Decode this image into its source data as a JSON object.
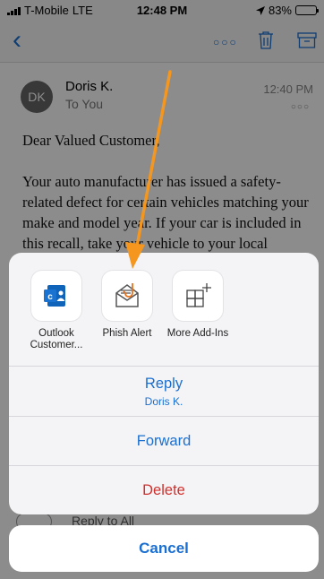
{
  "status_bar": {
    "carrier": "T-Mobile",
    "network": "LTE",
    "time": "12:48 PM",
    "battery": "83%",
    "battery_color": "#f4c20d"
  },
  "nav": {
    "back_icon": "chevron-left-icon",
    "more_icon": "ellipsis-icon",
    "more_glyph": "○○○",
    "trash_icon": "trash-icon",
    "archive_icon": "archive-icon"
  },
  "message": {
    "avatar_initials": "DK",
    "sender": "Doris K.",
    "recipient": "To You",
    "time": "12:40 PM",
    "dots": "○○○",
    "greeting": "Dear Valued Customer,",
    "body": "Your auto manufacturer has issued a safety-related defect for certain vehicles matching your make and model year. If your car is included in this recall, take your vehicle to your local"
  },
  "reply_bar": {
    "label": "Reply to All"
  },
  "action_sheet": {
    "addins": [
      {
        "label": "Outlook Customer...",
        "icon": "outlook-customer-manager-icon"
      },
      {
        "label": "Phish Alert",
        "icon": "phish-alert-icon"
      },
      {
        "label": "More Add-Ins",
        "icon": "add-grid-icon"
      }
    ],
    "reply": {
      "label": "Reply",
      "sublabel": "Doris K."
    },
    "forward": {
      "label": "Forward"
    },
    "delete": {
      "label": "Delete"
    },
    "cancel": {
      "label": "Cancel"
    }
  },
  "colors": {
    "accent": "#1a6fd1",
    "destructive": "#d0302d",
    "annotation_arrow": "#f5961e"
  }
}
